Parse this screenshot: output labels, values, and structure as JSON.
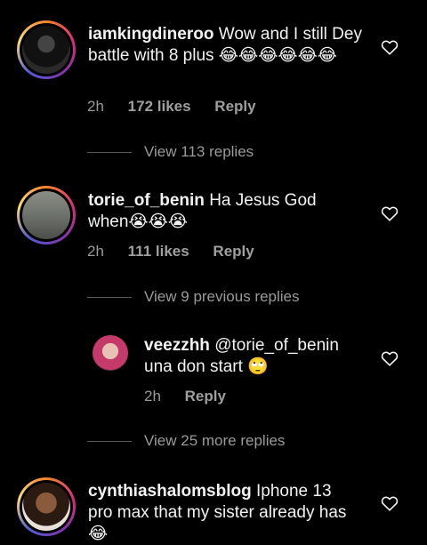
{
  "comments": [
    {
      "username": "iamkingdineroo",
      "text": "Wow and I still Dey battle with 8 plus 😂😂😂😂😂😂",
      "time": "2h",
      "likes": "172 likes",
      "reply": "Reply",
      "view_replies": "View 113 replies"
    },
    {
      "username": "torie_of_benin",
      "text": "Ha Jesus God when😭😭😭",
      "time": "2h",
      "likes": "111 likes",
      "reply": "Reply",
      "view_replies": "View 9 previous replies"
    },
    {
      "username": "veezzhh",
      "text": "@torie_of_benin una don start 🙄",
      "time": "2h",
      "reply": "Reply",
      "view_replies": "View 25 more replies"
    },
    {
      "username": "cynthiashalomsblog",
      "text": "Iphone 13 pro max that my sister already has😂"
    }
  ],
  "colors": {
    "background": "#000000",
    "text": "#f2f2f2",
    "secondary_text": "#9a9a9a",
    "divider": "#5a5a5a"
  },
  "icons": {
    "like": "heart-outline-icon"
  }
}
